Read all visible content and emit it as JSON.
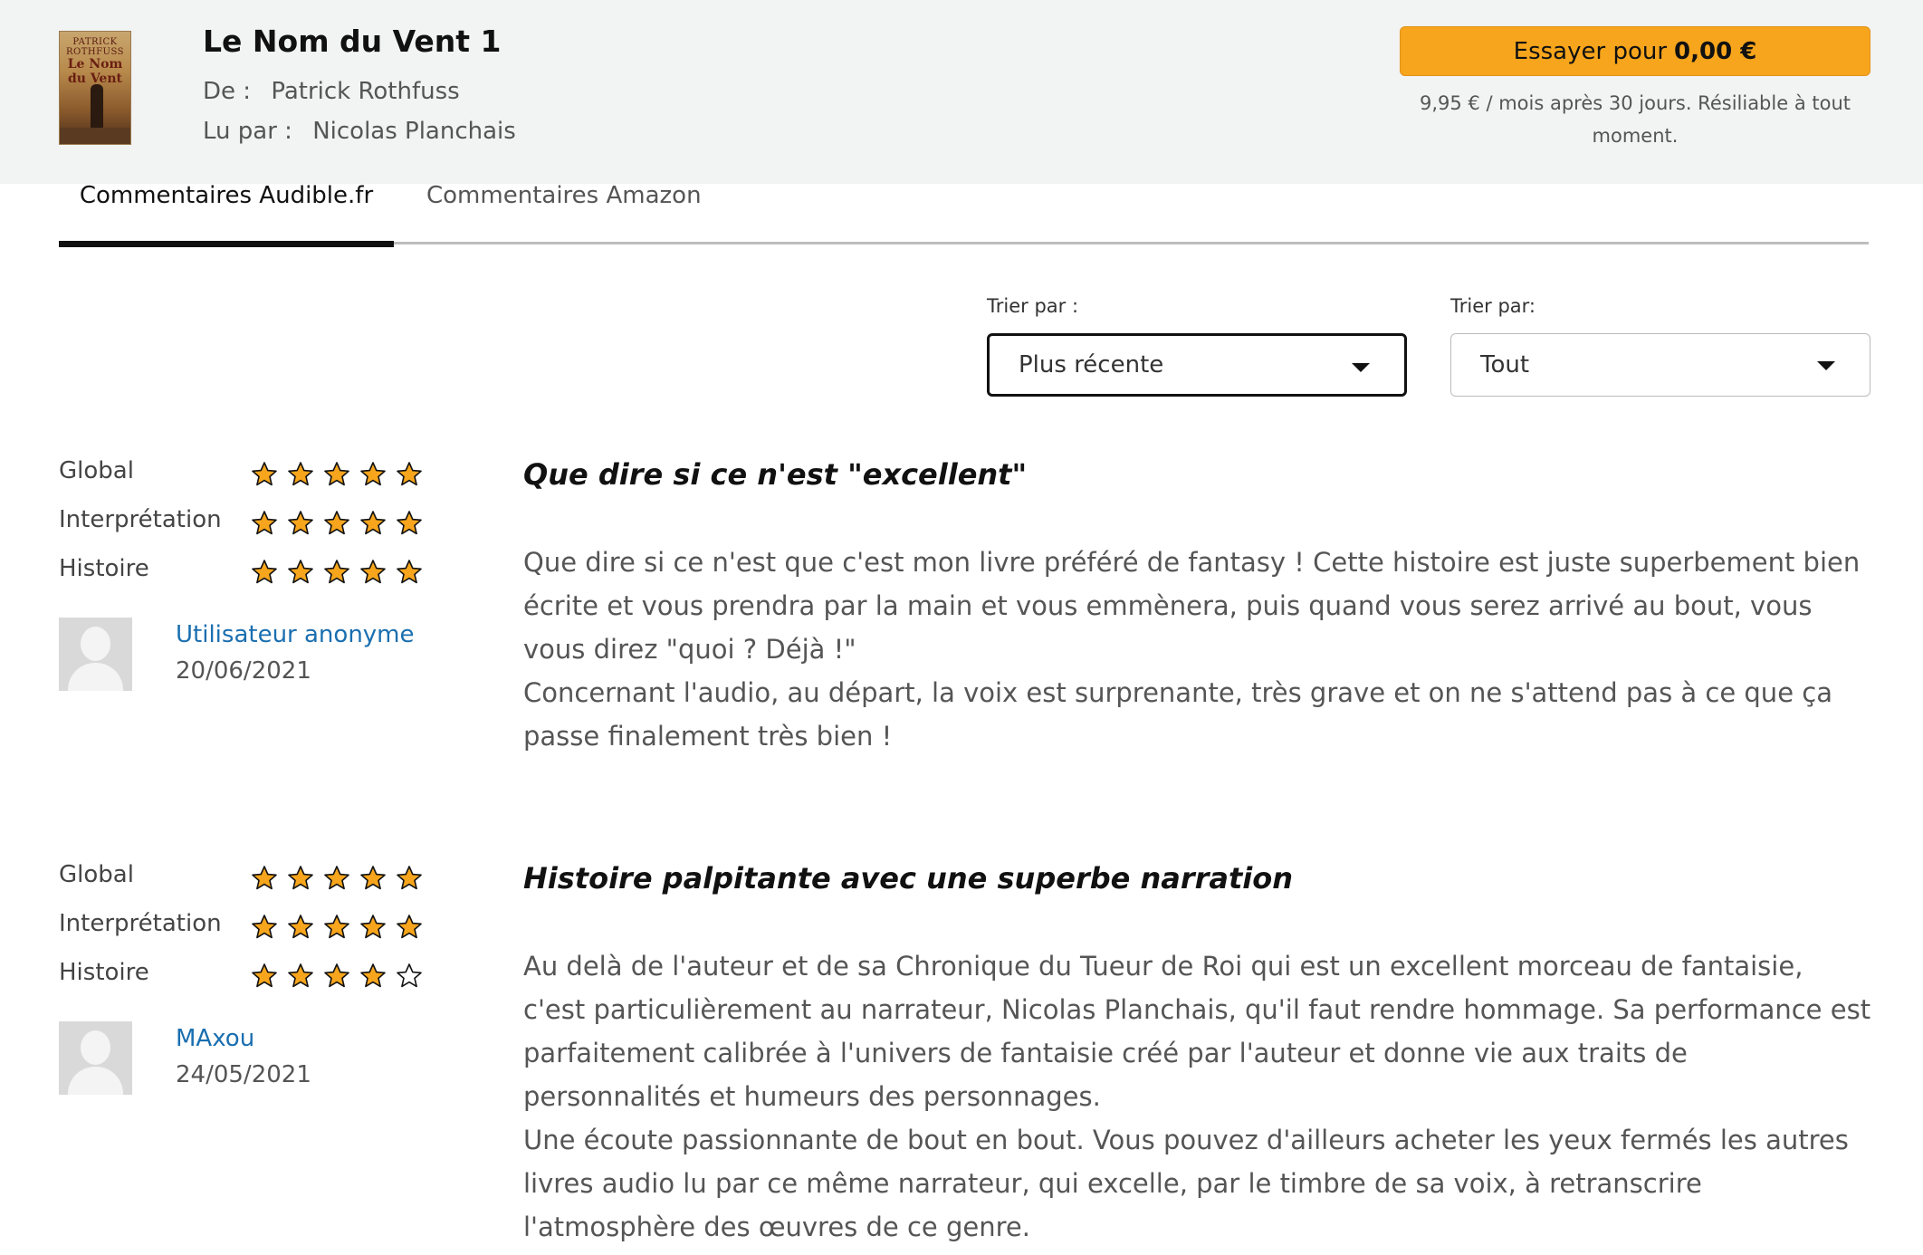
{
  "book": {
    "title": "Le Nom du Vent 1",
    "author_label": "De :",
    "author": "Patrick Rothfuss",
    "narrator_label": "Lu par :",
    "narrator": "Nicolas Planchais",
    "cover_author": "PATRICK ROTHFUSS",
    "cover_title": "Le Nom du Vent"
  },
  "offer": {
    "button_text": "Essayer pour",
    "button_price": "0,00 €",
    "note": "9,95 € / mois après 30 jours. Résiliable à tout moment.",
    "accent_color": "#f7a51c"
  },
  "tabs": [
    {
      "label": "Commentaires Audible.fr",
      "active": true
    },
    {
      "label": "Commentaires Amazon",
      "active": false
    }
  ],
  "sort": {
    "label_1": "Trier par :",
    "value_1": "Plus récente",
    "label_2": "Trier par:",
    "value_2": "Tout"
  },
  "reviews": [
    {
      "ratings": [
        {
          "label": "Global",
          "stars": 5
        },
        {
          "label": "Interprétation",
          "stars": 5
        },
        {
          "label": "Histoire",
          "stars": 5
        }
      ],
      "user": "Utilisateur anonyme",
      "date": "20/06/2021",
      "title": "Que dire si ce n'est \"excellent\"",
      "body": [
        "Que dire si ce n'est que c'est mon livre préféré de fantasy ! Cette histoire est juste superbement bien écrite et vous prendra par la main et vous emmènera, puis quand vous serez arrivé au bout, vous vous direz \"quoi ? Déjà !\"",
        "Concernant l'audio, au départ, la voix est surprenante, très grave et on ne s'attend pas à ce que ça passe finalement très bien !"
      ]
    },
    {
      "ratings": [
        {
          "label": "Global",
          "stars": 5
        },
        {
          "label": "Interprétation",
          "stars": 5
        },
        {
          "label": "Histoire",
          "stars": 4
        }
      ],
      "user": "MAxou",
      "date": "24/05/2021",
      "title": "Histoire palpitante avec une superbe narration",
      "body": [
        "Au delà de l'auteur et de sa Chronique du Tueur de Roi qui est un excellent morceau de fantaisie, c'est particulièrement au narrateur, Nicolas Planchais, qu'il faut rendre hommage. Sa performance est parfaitement calibrée à l'univers de fantaisie créé par l'auteur et donne vie aux traits de personnalités et humeurs des personnages.",
        "Une écoute passionnante de bout en bout. Vous pouvez d'ailleurs acheter les yeux fermés les autres livres audio lu par ce même narrateur, qui excelle, par le timbre de sa voix, à retranscrire l'atmosphère des œuvres de ce genre."
      ]
    }
  ],
  "icons": {
    "star_full_color": "#f7a51c",
    "star_outline_color": "#111111"
  }
}
